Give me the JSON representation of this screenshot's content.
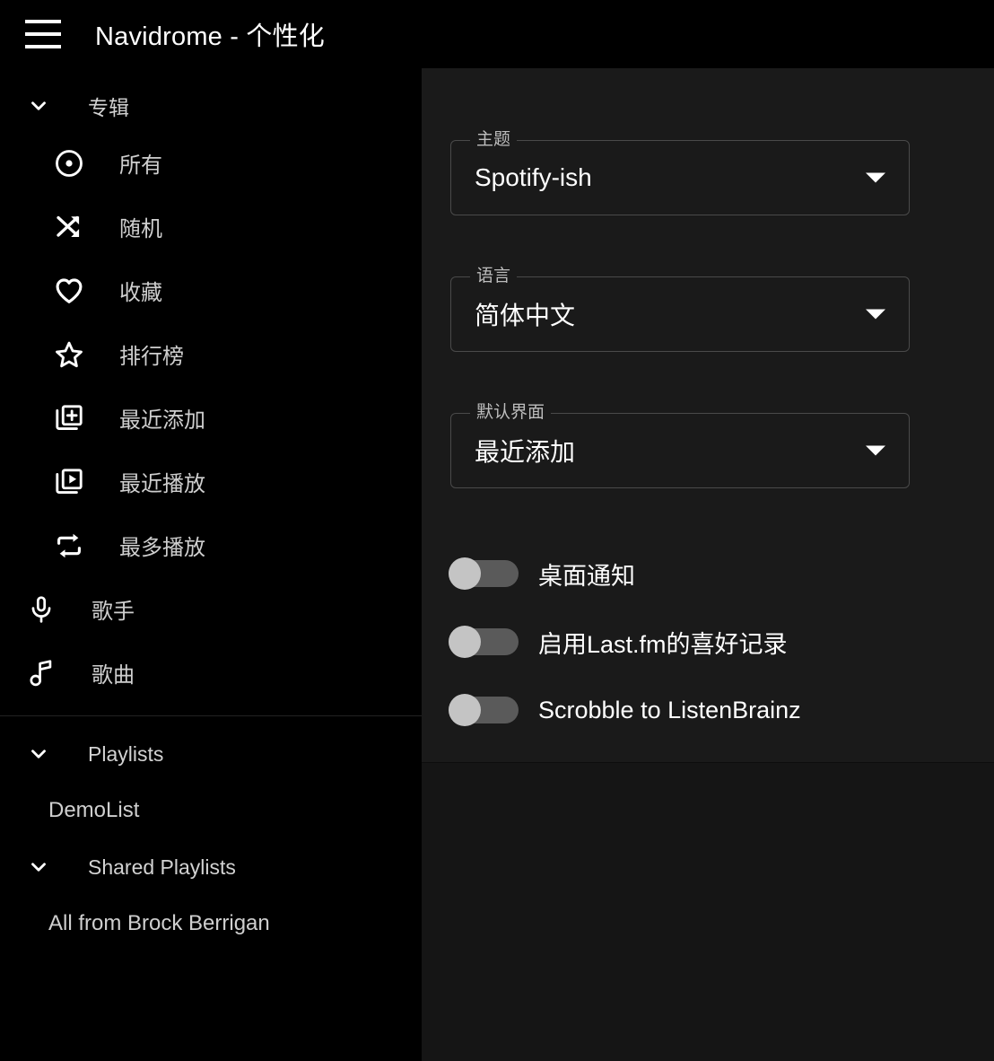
{
  "appbar": {
    "menu_icon": "hamburger-menu-icon",
    "title": "Navidrome - 个性化"
  },
  "sidebar": {
    "albums_group": {
      "label": "专辑",
      "expanded": true,
      "chevron_icon": "chevron-down-icon",
      "items": [
        {
          "label": "所有",
          "icon": "album-disc-icon"
        },
        {
          "label": "随机",
          "icon": "shuffle-icon"
        },
        {
          "label": "收藏",
          "icon": "heart-outline-icon"
        },
        {
          "label": "排行榜",
          "icon": "star-outline-icon"
        },
        {
          "label": "最近添加",
          "icon": "library-add-icon"
        },
        {
          "label": "最近播放",
          "icon": "library-play-icon"
        },
        {
          "label": "最多播放",
          "icon": "repeat-icon"
        }
      ]
    },
    "top_items": [
      {
        "label": "歌手",
        "icon": "microphone-icon"
      },
      {
        "label": "歌曲",
        "icon": "music-note-icon"
      }
    ],
    "playlists_group": {
      "label": "Playlists",
      "expanded": true,
      "chevron_icon": "chevron-down-icon",
      "items": [
        {
          "label": "DemoList"
        }
      ]
    },
    "shared_playlists_group": {
      "label": "Shared Playlists",
      "expanded": true,
      "chevron_icon": "chevron-down-icon",
      "items": [
        {
          "label": "All from Brock Berrigan"
        }
      ]
    }
  },
  "settings": {
    "fields": [
      {
        "label": "主题",
        "value": "Spotify-ish",
        "caret_icon": "dropdown-caret-icon"
      },
      {
        "label": "语言",
        "value": "简体中文",
        "caret_icon": "dropdown-caret-icon"
      },
      {
        "label": "默认界面",
        "value": "最近添加",
        "caret_icon": "dropdown-caret-icon"
      }
    ],
    "switches": [
      {
        "label": "桌面通知",
        "checked": false
      },
      {
        "label": "启用Last.fm的喜好记录",
        "checked": false
      },
      {
        "label": "Scrobble to ListenBrainz",
        "checked": false
      }
    ]
  },
  "colors": {
    "background": "#000000",
    "panel": "#1a1a1a",
    "panel_outer": "#151515",
    "text_primary": "#ffffff",
    "text_secondary": "#cfcfcf",
    "field_border": "#4a4a4a",
    "switch_track": "#5a5a5a",
    "switch_thumb": "#c4c4c4"
  }
}
